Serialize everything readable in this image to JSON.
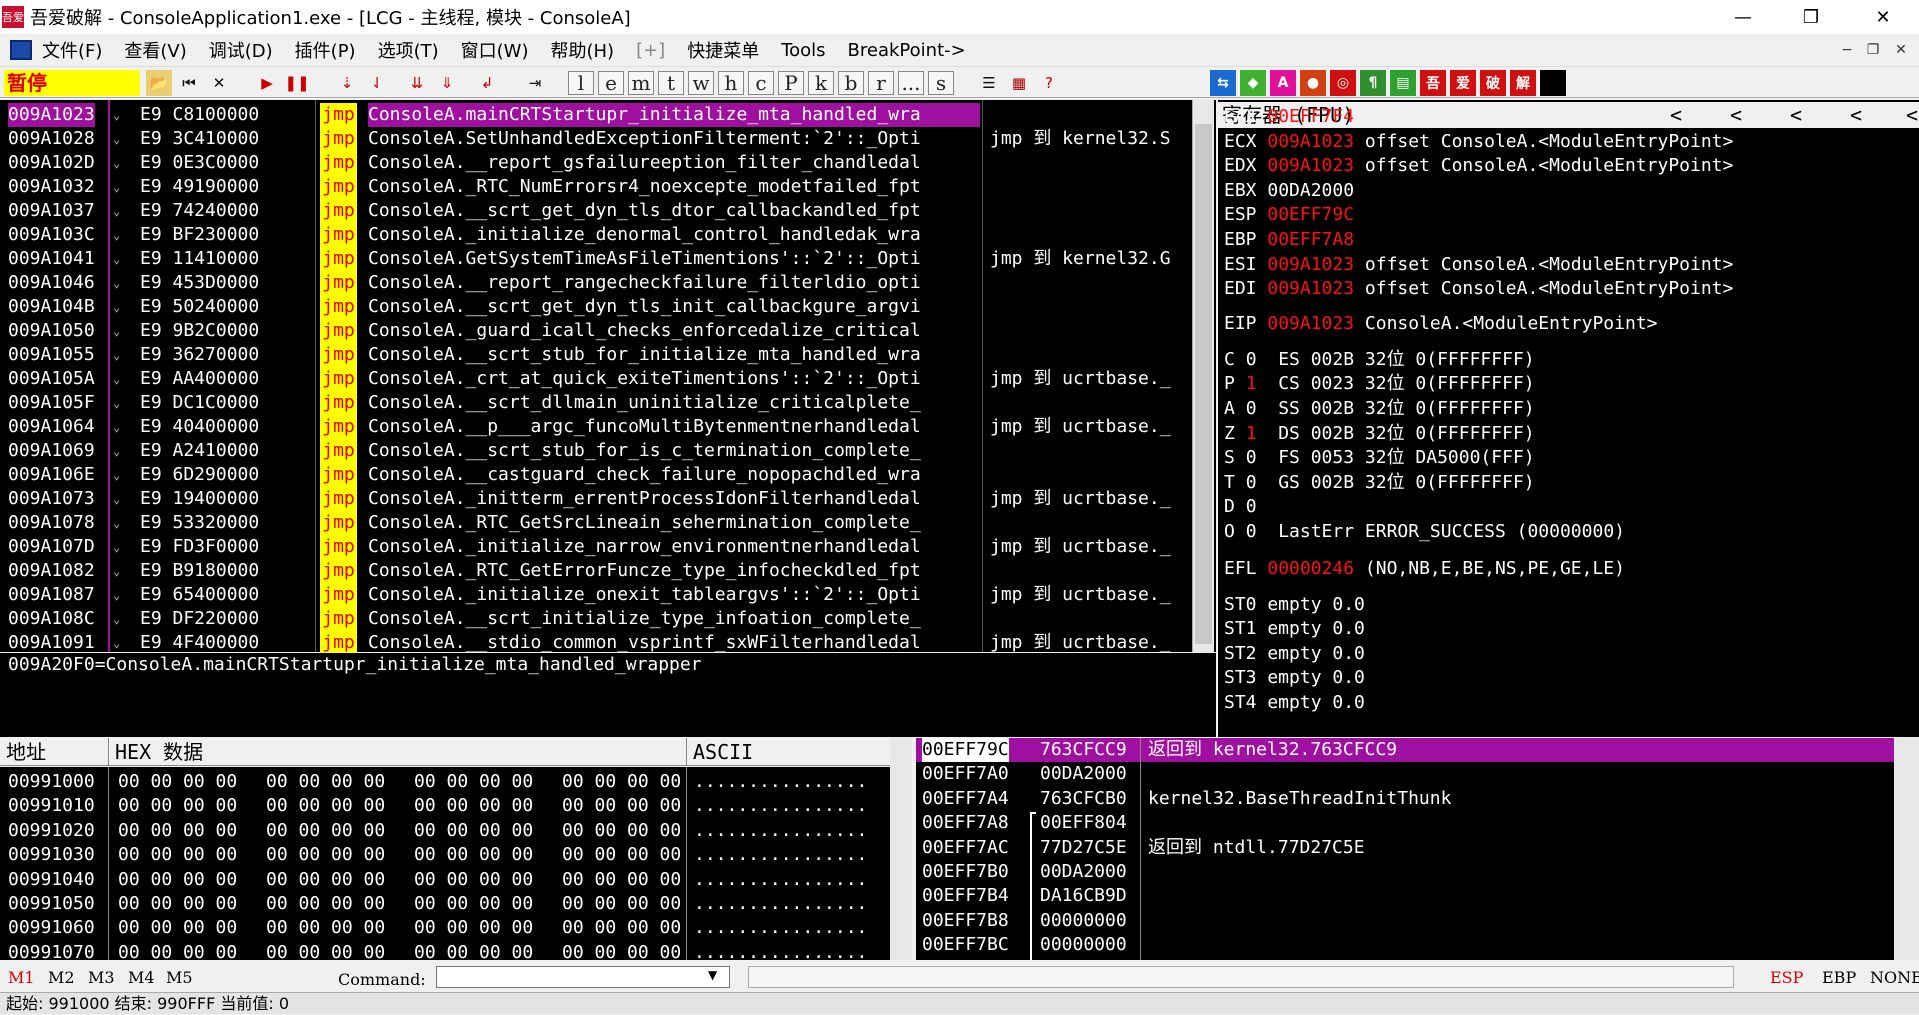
{
  "window": {
    "title": "吾爱破解 - ConsoleApplication1.exe - [LCG - 主线程, 模块 - ConsoleA]",
    "app_icon_text": "吾爱",
    "minimize": "—",
    "restore": "❐",
    "close": "✕"
  },
  "menu": {
    "items": [
      "文件(F)",
      "查看(V)",
      "调试(D)",
      "插件(P)",
      "选项(T)",
      "窗口(W)",
      "帮助(H)",
      "[+]",
      "快捷菜单",
      "Tools",
      "BreakPoint->"
    ],
    "mdi_min": "−",
    "mdi_restore": "❐",
    "mdi_close": "✕"
  },
  "toolbar": {
    "status": "暂停",
    "letters": [
      "l",
      "e",
      "m",
      "t",
      "w",
      "h",
      "c",
      "P",
      "k",
      "b",
      "r",
      "...",
      "s"
    ],
    "right_icons": [
      "吾",
      "爱",
      "破",
      "解"
    ]
  },
  "cpu": {
    "rows": [
      {
        "addr": "009A1023",
        "hex": "E9 C8100000",
        "op": "jmp",
        "text": "ConsoleA.mainCRTStartupr_initialize_mta_handled_wra",
        "cmt": "",
        "sel": true
      },
      {
        "addr": "009A1028",
        "hex": "E9 3C410000",
        "op": "jmp",
        "text": "ConsoleA.SetUnhandledExceptionFilterment:`2'::_Opti",
        "cmt": "jmp 到 kernel32.S"
      },
      {
        "addr": "009A102D",
        "hex": "E9 0E3C0000",
        "op": "jmp",
        "text": "ConsoleA.__report_gsfailureeption_filter_chandledal",
        "cmt": ""
      },
      {
        "addr": "009A1032",
        "hex": "E9 49190000",
        "op": "jmp",
        "text": "ConsoleA._RTC_NumErrorsr4_noexcepte_modetfailed_fpt",
        "cmt": ""
      },
      {
        "addr": "009A1037",
        "hex": "E9 74240000",
        "op": "jmp",
        "text": "ConsoleA.__scrt_get_dyn_tls_dtor_callbackandled_fpt",
        "cmt": ""
      },
      {
        "addr": "009A103C",
        "hex": "E9 BF230000",
        "op": "jmp",
        "text": "ConsoleA._initialize_denormal_control_handledak_wra",
        "cmt": ""
      },
      {
        "addr": "009A1041",
        "hex": "E9 11410000",
        "op": "jmp",
        "text": "ConsoleA.GetSystemTimeAsFileTimentions'::`2'::_Opti",
        "cmt": "jmp 到 kernel32.G"
      },
      {
        "addr": "009A1046",
        "hex": "E9 453D0000",
        "op": "jmp",
        "text": "ConsoleA.__report_rangecheckfailure_filterldio_opti",
        "cmt": ""
      },
      {
        "addr": "009A104B",
        "hex": "E9 50240000",
        "op": "jmp",
        "text": "ConsoleA.__scrt_get_dyn_tls_init_callbackgure_argvi",
        "cmt": ""
      },
      {
        "addr": "009A1050",
        "hex": "E9 9B2C0000",
        "op": "jmp",
        "text": "ConsoleA._guard_icall_checks_enforcedalize_critical",
        "cmt": ""
      },
      {
        "addr": "009A1055",
        "hex": "E9 36270000",
        "op": "jmp",
        "text": "ConsoleA.__scrt_stub_for_initialize_mta_handled_wra",
        "cmt": ""
      },
      {
        "addr": "009A105A",
        "hex": "E9 AA400000",
        "op": "jmp",
        "text": "ConsoleA._crt_at_quick_exiteTimentions'::`2'::_Opti",
        "cmt": "jmp 到 ucrtbase._"
      },
      {
        "addr": "009A105F",
        "hex": "E9 DC1C0000",
        "op": "jmp",
        "text": "ConsoleA.__scrt_dllmain_uninitialize_criticalplete_",
        "cmt": ""
      },
      {
        "addr": "009A1064",
        "hex": "E9 40400000",
        "op": "jmp",
        "text": "ConsoleA.__p___argc_funcoMultiBytenmentnerhandledal",
        "cmt": "jmp 到 ucrtbase._"
      },
      {
        "addr": "009A1069",
        "hex": "E9 A2410000",
        "op": "jmp",
        "text": "ConsoleA.__scrt_stub_for_is_c_termination_complete_",
        "cmt": ""
      },
      {
        "addr": "009A106E",
        "hex": "E9 6D290000",
        "op": "jmp",
        "text": "ConsoleA.__castguard_check_failure_nopopachdled_wra",
        "cmt": ""
      },
      {
        "addr": "009A1073",
        "hex": "E9 19400000",
        "op": "jmp",
        "text": "ConsoleA._initterm_errentProcessIdonFilterhandledal",
        "cmt": "jmp 到 ucrtbase._"
      },
      {
        "addr": "009A1078",
        "hex": "E9 53320000",
        "op": "jmp",
        "text": "ConsoleA._RTC_GetSrcLineain_sehermination_complete_",
        "cmt": ""
      },
      {
        "addr": "009A107D",
        "hex": "E9 FD3F0000",
        "op": "jmp",
        "text": "ConsoleA._initialize_narrow_environmentnerhandledal",
        "cmt": "jmp 到 ucrtbase._"
      },
      {
        "addr": "009A1082",
        "hex": "E9 B9180000",
        "op": "jmp",
        "text": "ConsoleA._RTC_GetErrorFuncze_type_infocheckdled_fpt",
        "cmt": ""
      },
      {
        "addr": "009A1087",
        "hex": "E9 65400000",
        "op": "jmp",
        "text": "ConsoleA._initialize_onexit_tableargvs'::`2'::_Opti",
        "cmt": "jmp 到 ucrtbase._"
      },
      {
        "addr": "009A108C",
        "hex": "E9 DF220000",
        "op": "jmp",
        "text": "ConsoleA.__scrt_initialize_type_infoation_complete_",
        "cmt": ""
      },
      {
        "addr": "009A1091",
        "hex": "E9 4F400000",
        "op": "jmp",
        "text": "ConsoleA.__stdio_common_vsprintf_sxWFilterhandledal",
        "cmt": "jmp 到 ucrtbase._"
      }
    ],
    "info_line": "009A20F0=ConsoleA.mainCRTStartupr_initialize_mta_handled_wrapper"
  },
  "registers": {
    "header": "寄存器 (FPU)",
    "arrows": [
      "<",
      "<",
      "<",
      "<",
      "<"
    ],
    "gp": [
      {
        "name": "EAX",
        "value": "00EFF7F4",
        "red": true,
        "note": ""
      },
      {
        "name": "ECX",
        "value": "009A1023",
        "red": true,
        "note": "offset ConsoleA.<ModuleEntryPoint>"
      },
      {
        "name": "EDX",
        "value": "009A1023",
        "red": true,
        "note": "offset ConsoleA.<ModuleEntryPoint>"
      },
      {
        "name": "EBX",
        "value": "00DA2000",
        "red": false,
        "note": ""
      },
      {
        "name": "ESP",
        "value": "00EFF79C",
        "red": true,
        "note": ""
      },
      {
        "name": "EBP",
        "value": "00EFF7A8",
        "red": true,
        "note": ""
      },
      {
        "name": "ESI",
        "value": "009A1023",
        "red": true,
        "note": "offset ConsoleA.<ModuleEntryPoint>"
      },
      {
        "name": "EDI",
        "value": "009A1023",
        "red": true,
        "note": "offset ConsoleA.<ModuleEntryPoint>"
      }
    ],
    "eip": {
      "name": "EIP",
      "value": "009A1023",
      "note": "ConsoleA.<ModuleEntryPoint>"
    },
    "flags": [
      {
        "f": "C",
        "v": "0",
        "red": false,
        "seg": "ES 002B 32位 0(FFFFFFFF)"
      },
      {
        "f": "P",
        "v": "1",
        "red": true,
        "seg": "CS 0023 32位 0(FFFFFFFF)"
      },
      {
        "f": "A",
        "v": "0",
        "red": false,
        "seg": "SS 002B 32位 0(FFFFFFFF)"
      },
      {
        "f": "Z",
        "v": "1",
        "red": true,
        "seg": "DS 002B 32位 0(FFFFFFFF)"
      },
      {
        "f": "S",
        "v": "0",
        "red": false,
        "seg": "FS 0053 32位 DA5000(FFF)"
      },
      {
        "f": "T",
        "v": "0",
        "red": false,
        "seg": "GS 002B 32位 0(FFFFFFFF)"
      },
      {
        "f": "D",
        "v": "0",
        "red": false,
        "seg": ""
      },
      {
        "f": "O",
        "v": "0",
        "red": false,
        "seg": "LastErr ERROR_SUCCESS (00000000)"
      }
    ],
    "efl": {
      "name": "EFL",
      "value": "00000246",
      "note": "(NO,NB,E,BE,NS,PE,GE,LE)"
    },
    "fpu": [
      "ST0 empty 0.0",
      "ST1 empty 0.0",
      "ST2 empty 0.0",
      "ST3 empty 0.0",
      "ST4 empty 0.0"
    ]
  },
  "dump": {
    "col_addr": "地址",
    "col_hex": "HEX 数据",
    "col_ascii": "ASCII",
    "rows": [
      {
        "addr": "00991000",
        "hex": "00 00 00 00|00 00 00 00|00 00 00 00|00 00 00 00",
        "ascii": "................"
      },
      {
        "addr": "00991010",
        "hex": "00 00 00 00|00 00 00 00|00 00 00 00|00 00 00 00",
        "ascii": "................"
      },
      {
        "addr": "00991020",
        "hex": "00 00 00 00|00 00 00 00|00 00 00 00|00 00 00 00",
        "ascii": "................"
      },
      {
        "addr": "00991030",
        "hex": "00 00 00 00|00 00 00 00|00 00 00 00|00 00 00 00",
        "ascii": "................"
      },
      {
        "addr": "00991040",
        "hex": "00 00 00 00|00 00 00 00|00 00 00 00|00 00 00 00",
        "ascii": "................"
      },
      {
        "addr": "00991050",
        "hex": "00 00 00 00|00 00 00 00|00 00 00 00|00 00 00 00",
        "ascii": "................"
      },
      {
        "addr": "00991060",
        "hex": "00 00 00 00|00 00 00 00|00 00 00 00|00 00 00 00",
        "ascii": "................"
      },
      {
        "addr": "00991070",
        "hex": "00 00 00 00|00 00 00 00|00 00 00 00|00 00 00 00",
        "ascii": "................"
      }
    ]
  },
  "stack": {
    "rows": [
      {
        "addr": "00EFF79C",
        "val": "763CFCC9",
        "cmt": "返回到 kernel32.763CFCC9",
        "sel": true
      },
      {
        "addr": "00EFF7A0",
        "val": "00DA2000",
        "cmt": ""
      },
      {
        "addr": "00EFF7A4",
        "val": "763CFCB0",
        "cmt": "kernel32.BaseThreadInitThunk"
      },
      {
        "addr": "00EFF7A8",
        "val": "00EFF804",
        "cmt": ""
      },
      {
        "addr": "00EFF7AC",
        "val": "77D27C5E",
        "cmt": "返回到 ntdll.77D27C5E"
      },
      {
        "addr": "00EFF7B0",
        "val": "00DA2000",
        "cmt": ""
      },
      {
        "addr": "00EFF7B4",
        "val": "DA16CB9D",
        "cmt": ""
      },
      {
        "addr": "00EFF7B8",
        "val": "00000000",
        "cmt": ""
      },
      {
        "addr": "00EFF7BC",
        "val": "00000000",
        "cmt": ""
      }
    ]
  },
  "command": {
    "tabs": [
      "M1",
      "M2",
      "M3",
      "M4",
      "M5"
    ],
    "label": "Command:",
    "value": "",
    "esp": "ESP",
    "ebp": "EBP",
    "none": "NONE"
  },
  "status": {
    "text": "起始: 991000 结束: 990FFF 当前值: 0"
  },
  "colors": {
    "accent_purple": "#a010a0",
    "red": "#ff1010",
    "yellow": "#ffff00"
  }
}
